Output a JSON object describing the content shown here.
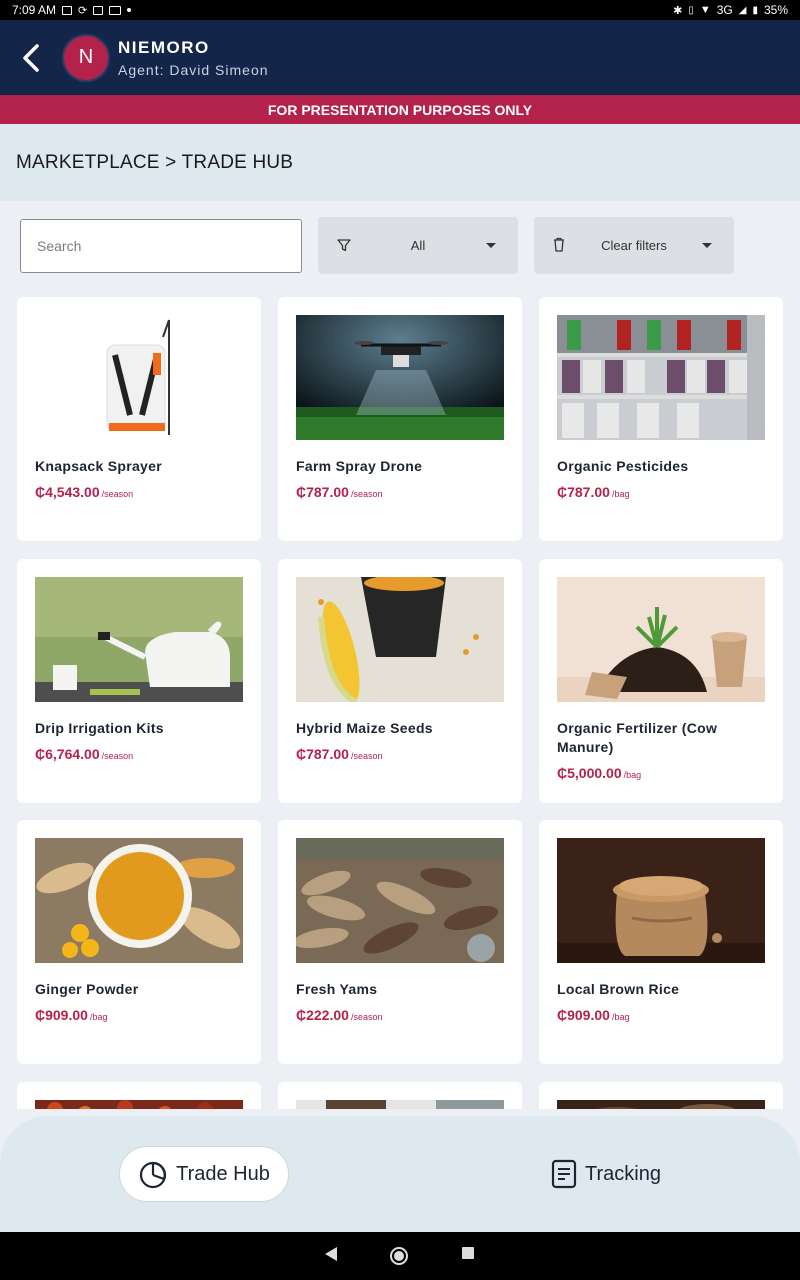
{
  "status_bar": {
    "time": "7:09 AM",
    "network": "3G",
    "battery": "35%"
  },
  "header": {
    "avatar_letter": "N",
    "name": "NIEMORO",
    "agent": "Agent: David Simeon"
  },
  "banner": "FOR PRESENTATION PURPOSES ONLY",
  "breadcrumb": "MARKETPLACE > TRADE HUB",
  "filters": {
    "search_placeholder": "Search",
    "category_value": "All",
    "clear_label": "Clear filters"
  },
  "products": [
    {
      "name": "Knapsack Sprayer",
      "price": "₵4,543.00",
      "unit": "/season",
      "image": "knapsack-sprayer"
    },
    {
      "name": "Farm Spray Drone",
      "price": "₵787.00",
      "unit": "/season",
      "image": "spray-drone"
    },
    {
      "name": "Organic Pesticides",
      "price": "₵787.00",
      "unit": "/bag",
      "image": "pesticide-shelves"
    },
    {
      "name": "Drip Irrigation Kits",
      "price": "₵6,764.00",
      "unit": "/season",
      "image": "watering-can"
    },
    {
      "name": "Hybrid Maize Seeds",
      "price": "₵787.00",
      "unit": "/season",
      "image": "maize"
    },
    {
      "name": "Organic Fertilizer (Cow Manure)",
      "price": "₵5,000.00",
      "unit": "/bag",
      "image": "soil-plant"
    },
    {
      "name": "Ginger Powder",
      "price": "₵909.00",
      "unit": "/bag",
      "image": "ginger-powder"
    },
    {
      "name": "Fresh Yams",
      "price": "₵222.00",
      "unit": "/season",
      "image": "yams"
    },
    {
      "name": "Local Brown Rice",
      "price": "₵909.00",
      "unit": "/bag",
      "image": "rice-sack"
    }
  ],
  "bottom_nav": {
    "trade_hub": "Trade Hub",
    "tracking": "Tracking"
  },
  "colors": {
    "primary": "#14254a",
    "accent": "#b3224b",
    "surface": "#dde8ef"
  }
}
